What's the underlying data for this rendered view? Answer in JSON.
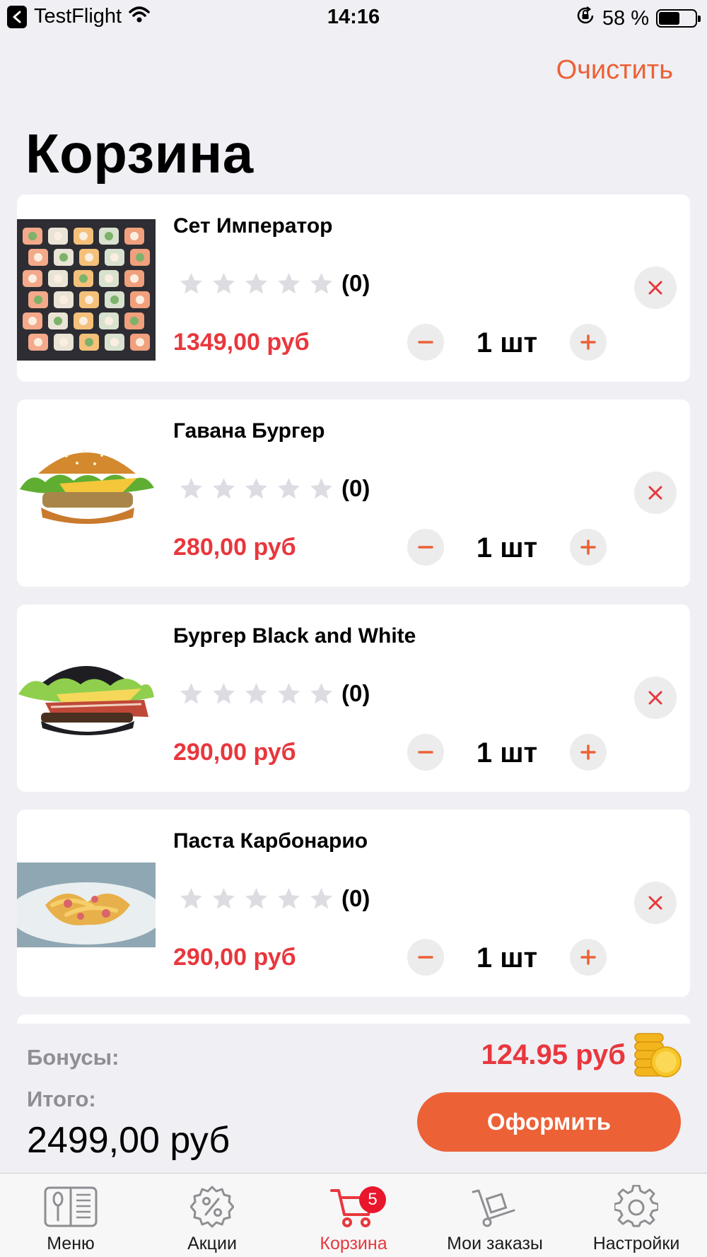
{
  "status_bar": {
    "app": "TestFlight",
    "time": "14:16",
    "battery": "58 %",
    "battery_level": 0.58
  },
  "header": {
    "clear_label": "Очистить",
    "title": "Корзина"
  },
  "cart": {
    "items": [
      {
        "name": "Сет Император",
        "rating_count": "(0)",
        "rating": 0,
        "price": "1349,00 руб",
        "qty": "1 шт",
        "image": "sushi-set-image"
      },
      {
        "name": "Гавана Бургер",
        "rating_count": "(0)",
        "rating": 0,
        "price": "280,00 руб",
        "qty": "1 шт",
        "image": "burger-image"
      },
      {
        "name": "Бургер Black and White",
        "rating_count": "(0)",
        "rating": 0,
        "price": "290,00 руб",
        "qty": "1 шт",
        "image": "black-burger-image"
      },
      {
        "name": "Паста Карбонарио",
        "rating_count": "(0)",
        "rating": 0,
        "price": "290,00 руб",
        "qty": "1 шт",
        "image": "pasta-image"
      }
    ]
  },
  "summary": {
    "bonus_label": "Бонусы:",
    "bonus_value": "124.95 руб",
    "total_label": "Итого:",
    "total_value": "2499,00 руб",
    "checkout_label": "Оформить"
  },
  "tab_bar": {
    "tabs": [
      {
        "label": "Меню",
        "icon": "menu-book-icon"
      },
      {
        "label": "Акции",
        "icon": "percent-badge-icon"
      },
      {
        "label": "Корзина",
        "icon": "cart-icon",
        "badge": "5",
        "active": true
      },
      {
        "label": "Мои заказы",
        "icon": "hand-truck-icon"
      },
      {
        "label": "Настройки",
        "icon": "gear-icon"
      }
    ]
  },
  "colors": {
    "accent": "#ec6136",
    "price": "#e8373d",
    "badge": "#e8172c",
    "star_empty": "#dcdce2",
    "background": "#efeff4"
  }
}
